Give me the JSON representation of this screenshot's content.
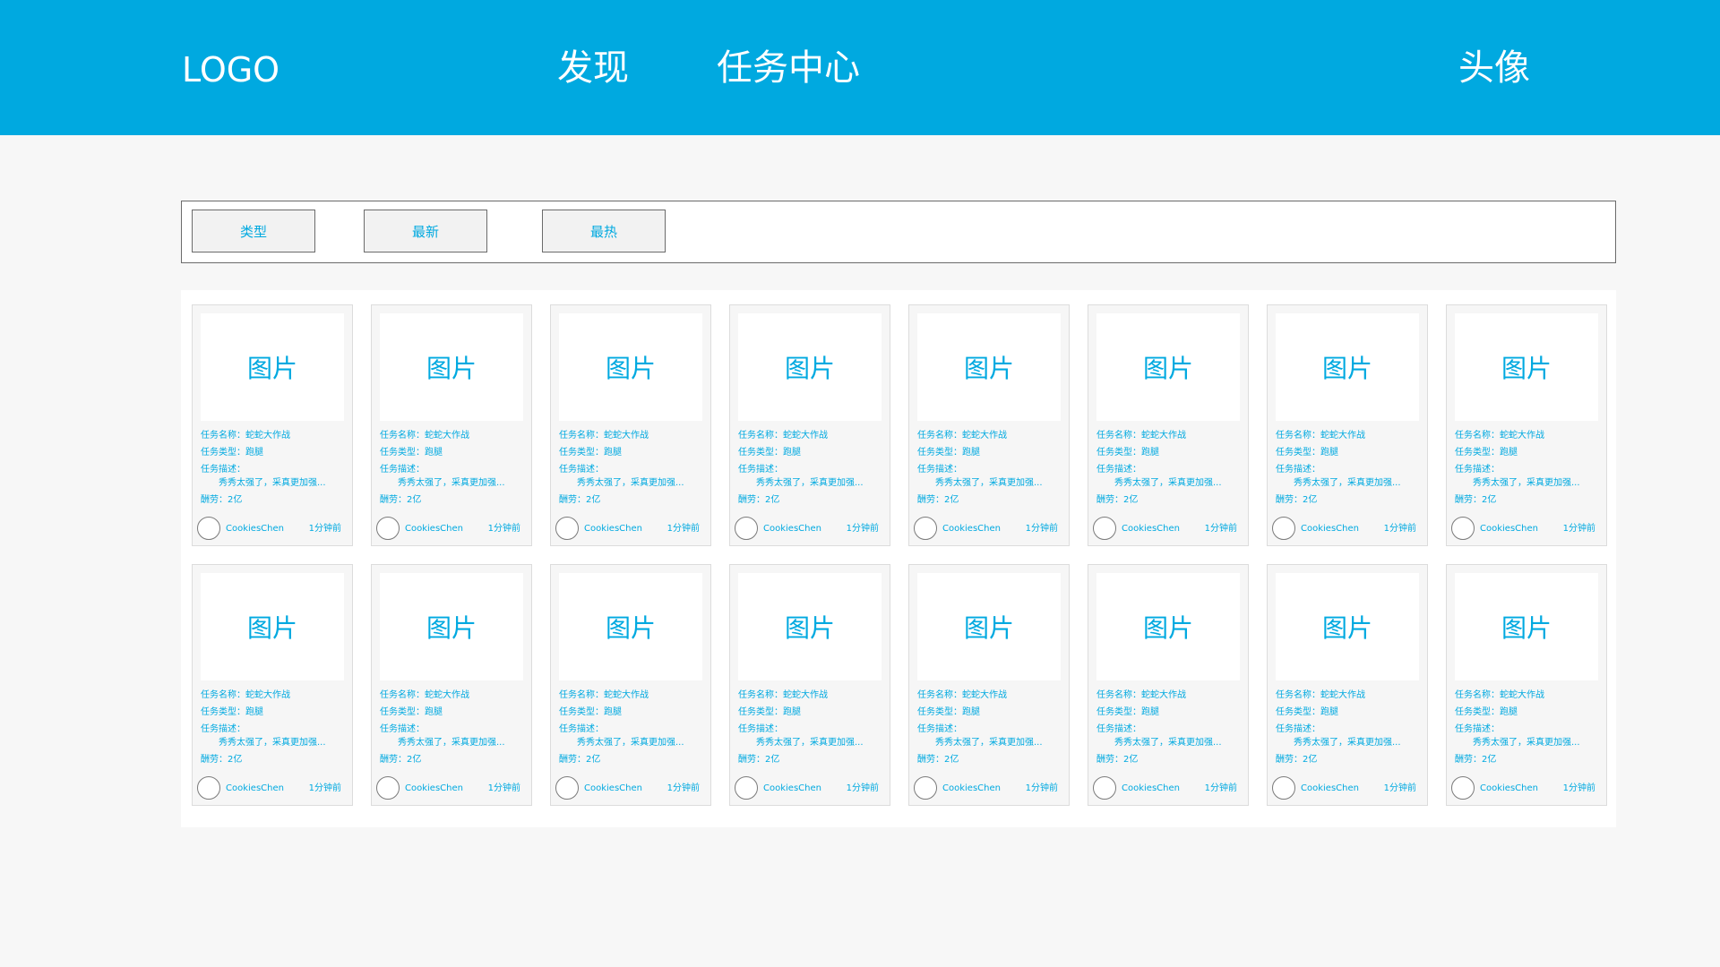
{
  "header": {
    "logo": "LOGO",
    "nav": [
      "发现",
      "任务中心"
    ],
    "avatar": "头像"
  },
  "filters": [
    "类型",
    "最新",
    "最热"
  ],
  "colors": {
    "accent": "#00a9e0",
    "page_background": "#f7f7f7",
    "card_background": "#f6f6f6"
  },
  "cards": [
    {
      "image_label": "图片",
      "name": "任务名称：蛇蛇大作战",
      "type": "任务类型：跑腿",
      "desc_label": "任务描述：",
      "desc": "秀秀太强了，采真更加强...",
      "reward": "酬劳：2亿",
      "user": "CookiesChen",
      "time": "1分钟前"
    },
    {
      "image_label": "图片",
      "name": "任务名称：蛇蛇大作战",
      "type": "任务类型：跑腿",
      "desc_label": "任务描述：",
      "desc": "秀秀太强了，采真更加强...",
      "reward": "酬劳：2亿",
      "user": "CookiesChen",
      "time": "1分钟前"
    },
    {
      "image_label": "图片",
      "name": "任务名称：蛇蛇大作战",
      "type": "任务类型：跑腿",
      "desc_label": "任务描述：",
      "desc": "秀秀太强了，采真更加强...",
      "reward": "酬劳：2亿",
      "user": "CookiesChen",
      "time": "1分钟前"
    },
    {
      "image_label": "图片",
      "name": "任务名称：蛇蛇大作战",
      "type": "任务类型：跑腿",
      "desc_label": "任务描述：",
      "desc": "秀秀太强了，采真更加强...",
      "reward": "酬劳：2亿",
      "user": "CookiesChen",
      "time": "1分钟前"
    },
    {
      "image_label": "图片",
      "name": "任务名称：蛇蛇大作战",
      "type": "任务类型：跑腿",
      "desc_label": "任务描述：",
      "desc": "秀秀太强了，采真更加强...",
      "reward": "酬劳：2亿",
      "user": "CookiesChen",
      "time": "1分钟前"
    },
    {
      "image_label": "图片",
      "name": "任务名称：蛇蛇大作战",
      "type": "任务类型：跑腿",
      "desc_label": "任务描述：",
      "desc": "秀秀太强了，采真更加强...",
      "reward": "酬劳：2亿",
      "user": "CookiesChen",
      "time": "1分钟前"
    },
    {
      "image_label": "图片",
      "name": "任务名称：蛇蛇大作战",
      "type": "任务类型：跑腿",
      "desc_label": "任务描述：",
      "desc": "秀秀太强了，采真更加强...",
      "reward": "酬劳：2亿",
      "user": "CookiesChen",
      "time": "1分钟前"
    },
    {
      "image_label": "图片",
      "name": "任务名称：蛇蛇大作战",
      "type": "任务类型：跑腿",
      "desc_label": "任务描述：",
      "desc": "秀秀太强了，采真更加强...",
      "reward": "酬劳：2亿",
      "user": "CookiesChen",
      "time": "1分钟前"
    },
    {
      "image_label": "图片",
      "name": "任务名称：蛇蛇大作战",
      "type": "任务类型：跑腿",
      "desc_label": "任务描述：",
      "desc": "秀秀太强了，采真更加强...",
      "reward": "酬劳：2亿",
      "user": "CookiesChen",
      "time": "1分钟前"
    },
    {
      "image_label": "图片",
      "name": "任务名称：蛇蛇大作战",
      "type": "任务类型：跑腿",
      "desc_label": "任务描述：",
      "desc": "秀秀太强了，采真更加强...",
      "reward": "酬劳：2亿",
      "user": "CookiesChen",
      "time": "1分钟前"
    },
    {
      "image_label": "图片",
      "name": "任务名称：蛇蛇大作战",
      "type": "任务类型：跑腿",
      "desc_label": "任务描述：",
      "desc": "秀秀太强了，采真更加强...",
      "reward": "酬劳：2亿",
      "user": "CookiesChen",
      "time": "1分钟前"
    },
    {
      "image_label": "图片",
      "name": "任务名称：蛇蛇大作战",
      "type": "任务类型：跑腿",
      "desc_label": "任务描述：",
      "desc": "秀秀太强了，采真更加强...",
      "reward": "酬劳：2亿",
      "user": "CookiesChen",
      "time": "1分钟前"
    },
    {
      "image_label": "图片",
      "name": "任务名称：蛇蛇大作战",
      "type": "任务类型：跑腿",
      "desc_label": "任务描述：",
      "desc": "秀秀太强了，采真更加强...",
      "reward": "酬劳：2亿",
      "user": "CookiesChen",
      "time": "1分钟前"
    },
    {
      "image_label": "图片",
      "name": "任务名称：蛇蛇大作战",
      "type": "任务类型：跑腿",
      "desc_label": "任务描述：",
      "desc": "秀秀太强了，采真更加强...",
      "reward": "酬劳：2亿",
      "user": "CookiesChen",
      "time": "1分钟前"
    },
    {
      "image_label": "图片",
      "name": "任务名称：蛇蛇大作战",
      "type": "任务类型：跑腿",
      "desc_label": "任务描述：",
      "desc": "秀秀太强了，采真更加强...",
      "reward": "酬劳：2亿",
      "user": "CookiesChen",
      "time": "1分钟前"
    },
    {
      "image_label": "图片",
      "name": "任务名称：蛇蛇大作战",
      "type": "任务类型：跑腿",
      "desc_label": "任务描述：",
      "desc": "秀秀太强了，采真更加强...",
      "reward": "酬劳：2亿",
      "user": "CookiesChen",
      "time": "1分钟前"
    }
  ]
}
